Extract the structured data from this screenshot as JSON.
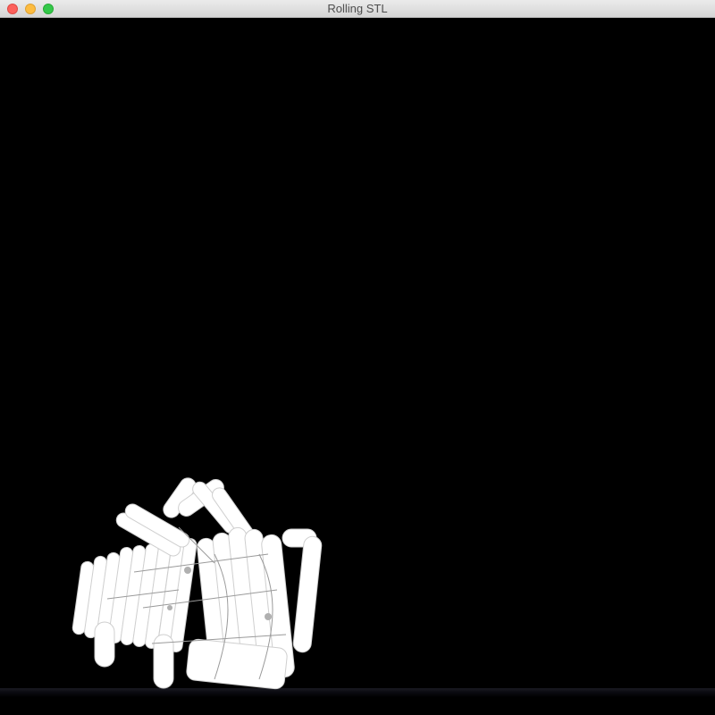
{
  "window": {
    "title": "Rolling STL",
    "controls": [
      "close",
      "minimize",
      "zoom"
    ]
  },
  "scene": {
    "background_color": "#000000",
    "model_color": "#ffffff",
    "ground_color": "#14141a",
    "object": "stl-model"
  }
}
